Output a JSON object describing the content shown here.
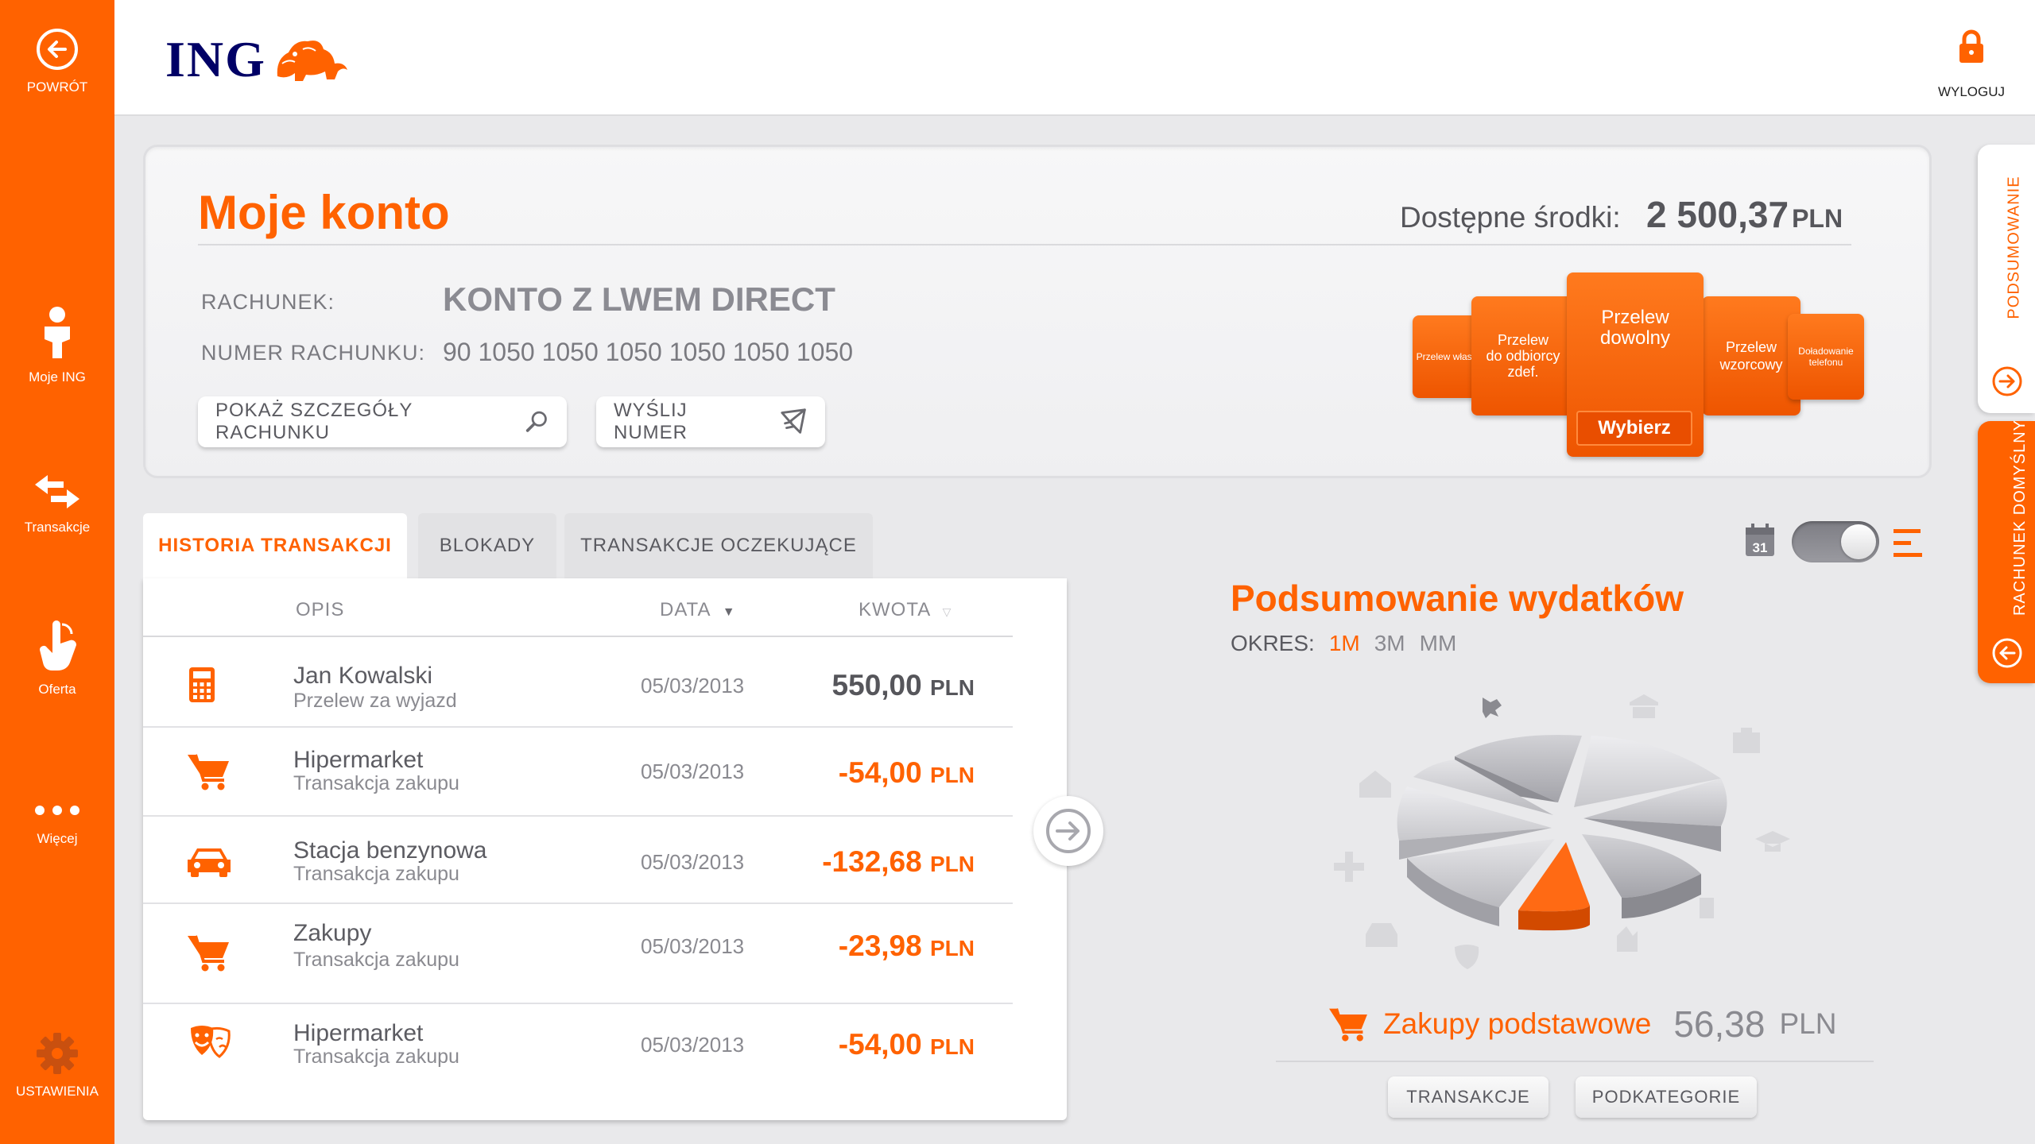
{
  "colors": {
    "brand": "#ff6200",
    "navy": "#000066"
  },
  "sidebar": {
    "items": [
      {
        "label": "POWRÓT",
        "icon": "back-arrow-icon"
      },
      {
        "label": "Moje ING",
        "icon": "person-icon"
      },
      {
        "label": "Transakcje",
        "icon": "transfer-arrows-icon"
      },
      {
        "label": "Oferta",
        "icon": "hand-pointer-icon"
      },
      {
        "label": "Więcej",
        "icon": "more-dots-icon"
      },
      {
        "label": "USTAWIENIA",
        "icon": "gear-icon"
      }
    ]
  },
  "header": {
    "logo_text": "ING",
    "logout_label": "WYLOGUJ"
  },
  "account": {
    "title": "Moje konto",
    "available_label": "Dostępne środki:",
    "available_value": "2 500,37",
    "available_currency": "PLN",
    "account_label": "RACHUNEK:",
    "account_name": "KONTO Z LWEM DIRECT",
    "number_label": "NUMER RACHUNKU:",
    "number_value": "90 1050 1050 1050 1050 1050 1050",
    "details_button": "POKAŻ SZCZEGÓŁY RACHUNKU",
    "send_button": "WYŚLIJ NUMER"
  },
  "transfers": {
    "own": "Przelew własny",
    "recipient_line1": "Przelew",
    "recipient_line2": "do odbiorcy",
    "recipient_line3": "zdef.",
    "free_line1": "Przelew",
    "free_line2": "dowolny",
    "choose": "Wybierz",
    "template_line1": "Przelew",
    "template_line2": "wzorcowy",
    "topup": "Doładowanie telefonu"
  },
  "side_tabs": {
    "summary": "PODSUMOWANIE",
    "default_account": "RACHUNEK DOMYŚLNY"
  },
  "tabs": [
    "HISTORIA TRANSAKCJI",
    "BLOKADY",
    "TRANSAKCJE OCZEKUJĄCE"
  ],
  "table": {
    "headers": {
      "description": "OPIS",
      "date": "DATA",
      "amount": "KWOTA"
    },
    "rows": [
      {
        "icon": "calculator-icon",
        "name": "Jan Kowalski",
        "sub": "Przelew za wyjazd",
        "date": "05/03/2013",
        "amount": "550,00",
        "currency": "PLN"
      },
      {
        "icon": "cart-icon",
        "name": "Hipermarket",
        "sub": "Transakcja zakupu",
        "date": "05/03/2013",
        "amount": "-54,00",
        "currency": "PLN"
      },
      {
        "icon": "car-icon",
        "name": "Stacja benzynowa",
        "sub": "Transakcja zakupu",
        "date": "05/03/2013",
        "amount": "-132,68",
        "currency": "PLN"
      },
      {
        "icon": "cart-icon",
        "name": "Zakupy",
        "sub": "Transakcja zakupu",
        "date": "05/03/2013",
        "amount": "-23,98",
        "currency": "PLN"
      },
      {
        "icon": "theater-masks-icon",
        "name": "Hipermarket",
        "sub": "Transakcja zakupu",
        "date": "05/03/2013",
        "amount": "-54,00",
        "currency": "PLN"
      }
    ]
  },
  "view_toggle": {
    "calendar_day": "31"
  },
  "summary": {
    "title": "Podsumowanie wydatków",
    "period_label": "OKRES:",
    "periods": [
      "1M",
      "3M",
      "MM"
    ],
    "active_period": "1M",
    "category": "Zakupy podstawowe",
    "value": "56,38",
    "currency": "PLN",
    "btn_transactions": "TRANSAKCJE",
    "btn_subcategories": "PODKATEGORIE"
  }
}
